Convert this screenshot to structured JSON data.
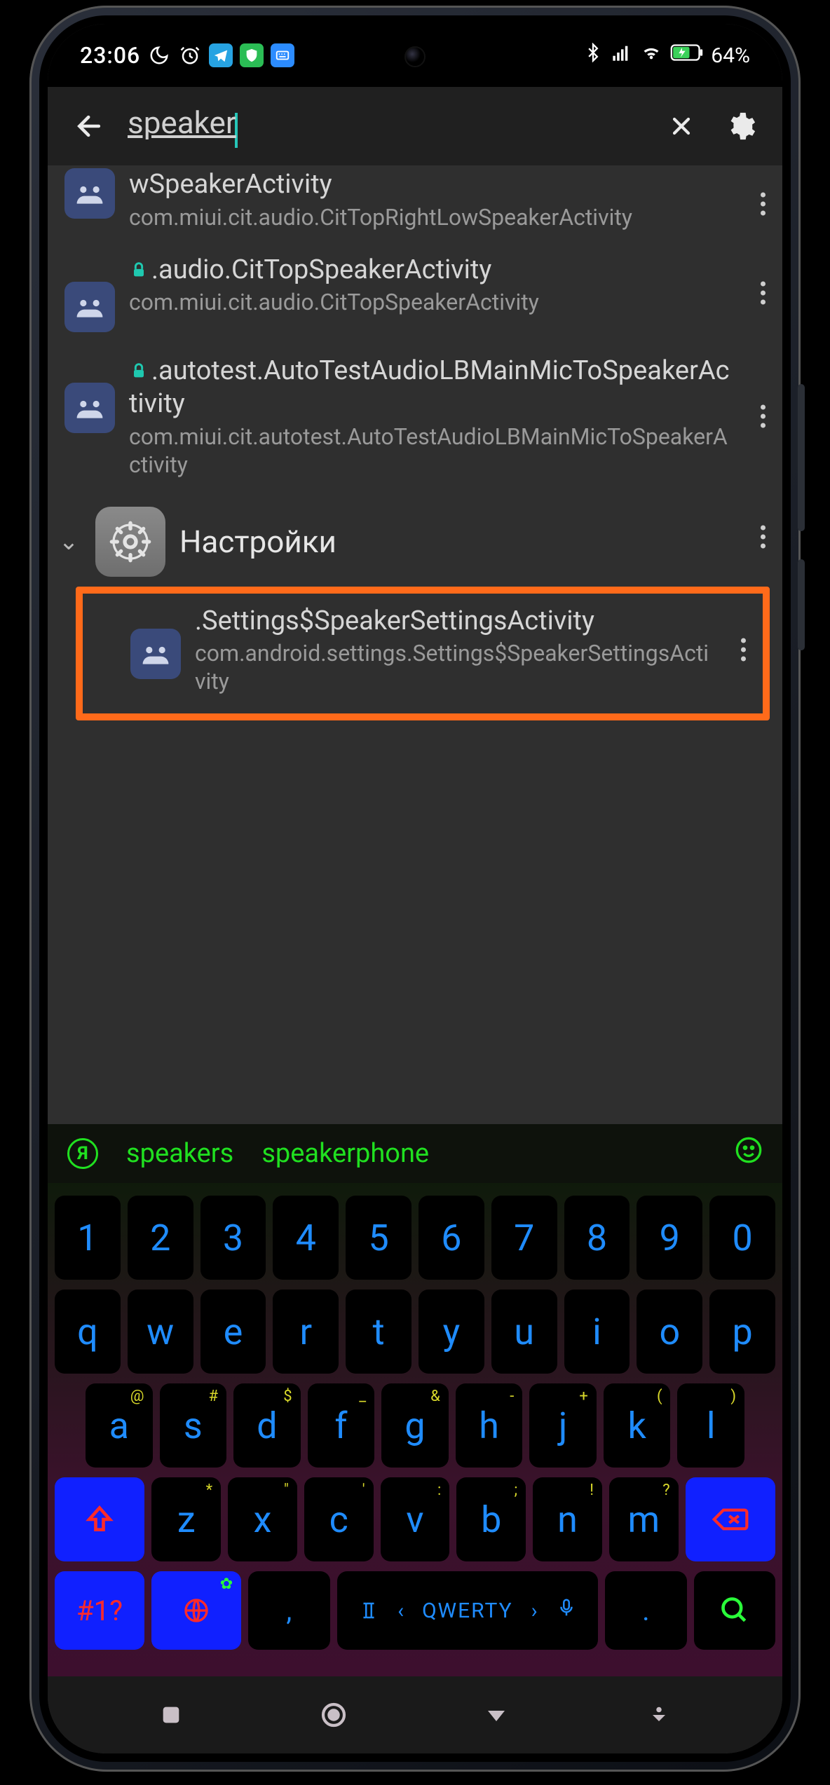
{
  "status": {
    "time": "23:06",
    "battery_pct": "64%",
    "icons": {
      "moon": "moon-icon",
      "alarm": "alarm-icon",
      "telegram": "telegram-icon",
      "shield": "shield-icon",
      "grid": "keyboard-app-icon",
      "bt": "bluetooth-icon",
      "signal": "signal-icon",
      "wifi": "wifi-icon",
      "battery": "battery-charging-icon"
    }
  },
  "search": {
    "value": "speaker",
    "clear_label": "Clear",
    "back_label": "Back",
    "settings_label": "Settings"
  },
  "results": [
    {
      "locked": false,
      "title": "wSpeakerActivity",
      "subtitle": "com.miui.cit.audio.CitTopRightLowSpeakerActivity"
    },
    {
      "locked": true,
      "title": ".audio.CitTopSpeakerActivity",
      "subtitle": "com.miui.cit.audio.CitTopSpeakerActivity"
    },
    {
      "locked": true,
      "title": ".autotest.AutoTestAudioLBMainMicToSpeakerActivity",
      "subtitle": "com.miui.cit.autotest.AutoTestAudioLBMainMicToSpeakerActivity"
    }
  ],
  "group": {
    "title": "Настройки"
  },
  "highlighted": {
    "title": ".Settings$SpeakerSettingsActivity",
    "subtitle": "com.android.settings.Settings$SpeakerSettingsActivity"
  },
  "suggestions": [
    "speakers",
    "speakerphone"
  ],
  "keyboard": {
    "row1": [
      "1",
      "2",
      "3",
      "4",
      "5",
      "6",
      "7",
      "8",
      "9",
      "0"
    ],
    "row2": [
      "q",
      "w",
      "e",
      "r",
      "t",
      "y",
      "u",
      "i",
      "o",
      "p"
    ],
    "row3": [
      {
        "k": "a",
        "s": "@"
      },
      {
        "k": "s",
        "s": "#"
      },
      {
        "k": "d",
        "s": "$"
      },
      {
        "k": "f",
        "s": "_"
      },
      {
        "k": "g",
        "s": "&"
      },
      {
        "k": "h",
        "s": "-"
      },
      {
        "k": "j",
        "s": "+"
      },
      {
        "k": "k",
        "s": "("
      },
      {
        "k": "l",
        "s": ")"
      }
    ],
    "row4": [
      {
        "k": "z",
        "s": "*"
      },
      {
        "k": "x",
        "s": "\""
      },
      {
        "k": "c",
        "s": "'"
      },
      {
        "k": "v",
        "s": ":"
      },
      {
        "k": "b",
        "s": ";"
      },
      {
        "k": "n",
        "s": "!"
      },
      {
        "k": "m",
        "s": "?"
      }
    ],
    "sym_label": "#1?",
    "space_label": "QWERTY",
    "comma": ",",
    "period": "."
  },
  "colors": {
    "highlight_border": "#ff6a1a",
    "accent_green": "#20e020",
    "key_blue": "#1f8cff"
  }
}
